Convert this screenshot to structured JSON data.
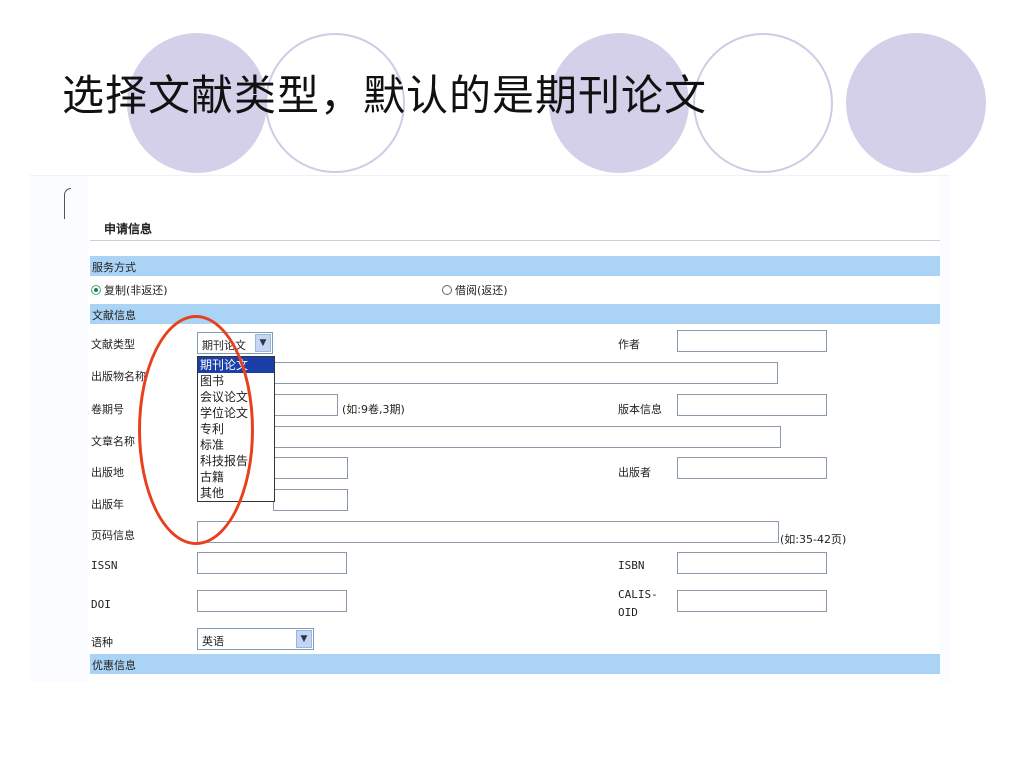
{
  "slide": {
    "title": "选择文献类型，默认的是期刊论文"
  },
  "form": {
    "section_title": "申请信息",
    "service_band": "服务方式",
    "service_options": [
      "复制(非返还)",
      "借阅(返还)"
    ],
    "doc_band": "文献信息",
    "fields": {
      "doc_type_label": "文献类型",
      "doc_type_value": "期刊论文",
      "author_label": "作者",
      "publication_label": "出版物名称",
      "volume_label": "卷期号",
      "volume_hint": "(如:9卷,3期)",
      "edition_label": "版本信息",
      "article_label": "文章名称",
      "place_label": "出版地",
      "publisher_label": "出版者",
      "year_label": "出版年",
      "pages_label": "页码信息",
      "pages_hint": "(如:35-42页)",
      "issn_label": "ISSN",
      "isbn_label": "ISBN",
      "doi_label": "DOI",
      "calis_label_1": "CALIS-",
      "calis_label_2": "OID",
      "lang_label": "语种",
      "lang_value": "英语"
    },
    "discount_band": "优惠信息",
    "doc_type_options": [
      "期刊论文",
      "图书",
      "会议论文",
      "学位论文",
      "专利",
      "标准",
      "科技报告",
      "古籍",
      "其他"
    ]
  },
  "colors": {
    "band": "#aad3f5",
    "highlight": "#e8401c",
    "circle": "#d4d0ea",
    "selected_option": "#1a3fa8"
  }
}
